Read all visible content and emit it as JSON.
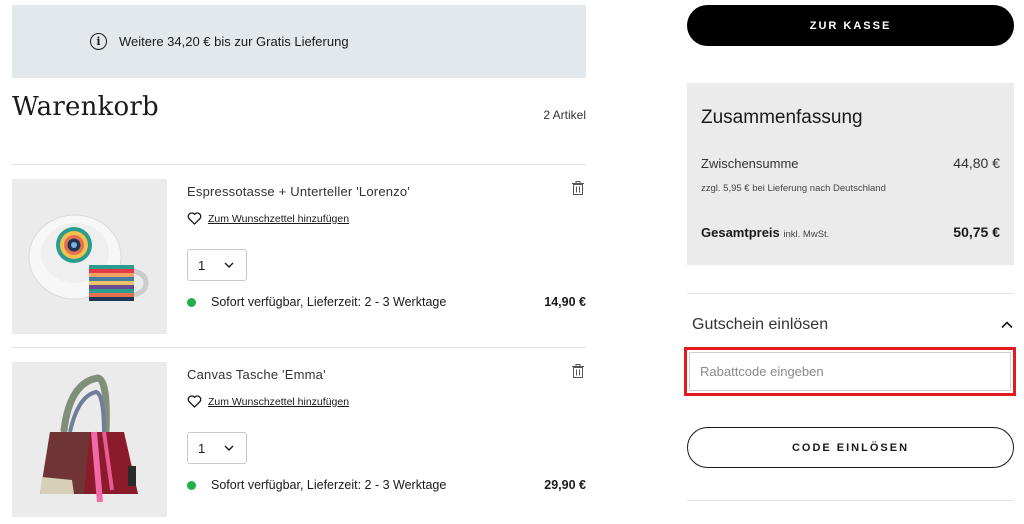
{
  "banner": {
    "icon": "info-icon",
    "text": "Weitere 34,20 € bis zur Gratis Lieferung"
  },
  "cart": {
    "title": "Warenkorb",
    "count": "2 Artikel"
  },
  "items": [
    {
      "name": "Espressotasse + Unterteller 'Lorenzo'",
      "wishlist_label": "Zum Wunschzettel hinzufügen",
      "quantity": "1",
      "availability": "Sofort verfügbar, Lieferzeit: 2 - 3 Werktage",
      "price": "14,90 €"
    },
    {
      "name": "Canvas Tasche 'Emma'",
      "wishlist_label": "Zum Wunschzettel hinzufügen",
      "quantity": "1",
      "availability": "Sofort verfügbar, Lieferzeit: 2 - 3 Werktage",
      "price": "29,90 €"
    }
  ],
  "checkout_label": "ZUR KASSE",
  "summary": {
    "title": "Zusammenfassung",
    "subtotal_label": "Zwischensumme",
    "subtotal_value": "44,80 €",
    "shipping_note": "zzgl. 5,95 € bei Lieferung nach Deutschland",
    "total_label": "Gesamtpreis",
    "total_note": "inkl. MwSt.",
    "total_value": "50,75 €"
  },
  "coupon": {
    "title": "Gutschein einlösen",
    "placeholder": "Rabattcode eingeben",
    "button_label": "CODE EINLÖSEN"
  },
  "colors": {
    "availability_dot": "#1eb14a",
    "highlight_border": "#e21b23",
    "banner_bg": "#e3e8ec"
  }
}
